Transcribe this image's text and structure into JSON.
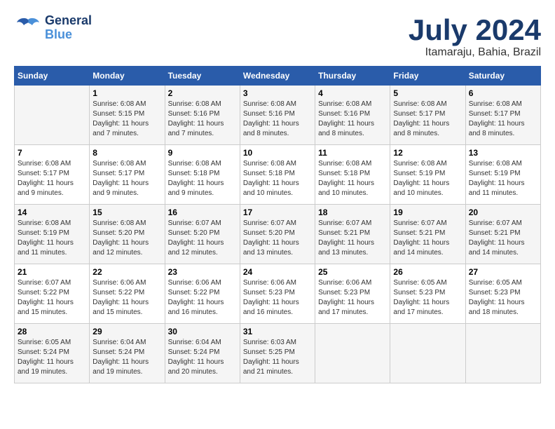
{
  "logo": {
    "general": "General",
    "blue": "Blue"
  },
  "title": {
    "month_year": "July 2024",
    "location": "Itamaraju, Bahia, Brazil"
  },
  "headers": [
    "Sunday",
    "Monday",
    "Tuesday",
    "Wednesday",
    "Thursday",
    "Friday",
    "Saturday"
  ],
  "weeks": [
    [
      {
        "day": "",
        "info": ""
      },
      {
        "day": "1",
        "info": "Sunrise: 6:08 AM\nSunset: 5:15 PM\nDaylight: 11 hours\nand 7 minutes."
      },
      {
        "day": "2",
        "info": "Sunrise: 6:08 AM\nSunset: 5:16 PM\nDaylight: 11 hours\nand 7 minutes."
      },
      {
        "day": "3",
        "info": "Sunrise: 6:08 AM\nSunset: 5:16 PM\nDaylight: 11 hours\nand 8 minutes."
      },
      {
        "day": "4",
        "info": "Sunrise: 6:08 AM\nSunset: 5:16 PM\nDaylight: 11 hours\nand 8 minutes."
      },
      {
        "day": "5",
        "info": "Sunrise: 6:08 AM\nSunset: 5:17 PM\nDaylight: 11 hours\nand 8 minutes."
      },
      {
        "day": "6",
        "info": "Sunrise: 6:08 AM\nSunset: 5:17 PM\nDaylight: 11 hours\nand 8 minutes."
      }
    ],
    [
      {
        "day": "7",
        "info": "Sunrise: 6:08 AM\nSunset: 5:17 PM\nDaylight: 11 hours\nand 9 minutes."
      },
      {
        "day": "8",
        "info": "Sunrise: 6:08 AM\nSunset: 5:17 PM\nDaylight: 11 hours\nand 9 minutes."
      },
      {
        "day": "9",
        "info": "Sunrise: 6:08 AM\nSunset: 5:18 PM\nDaylight: 11 hours\nand 9 minutes."
      },
      {
        "day": "10",
        "info": "Sunrise: 6:08 AM\nSunset: 5:18 PM\nDaylight: 11 hours\nand 10 minutes."
      },
      {
        "day": "11",
        "info": "Sunrise: 6:08 AM\nSunset: 5:18 PM\nDaylight: 11 hours\nand 10 minutes."
      },
      {
        "day": "12",
        "info": "Sunrise: 6:08 AM\nSunset: 5:19 PM\nDaylight: 11 hours\nand 10 minutes."
      },
      {
        "day": "13",
        "info": "Sunrise: 6:08 AM\nSunset: 5:19 PM\nDaylight: 11 hours\nand 11 minutes."
      }
    ],
    [
      {
        "day": "14",
        "info": "Sunrise: 6:08 AM\nSunset: 5:19 PM\nDaylight: 11 hours\nand 11 minutes."
      },
      {
        "day": "15",
        "info": "Sunrise: 6:08 AM\nSunset: 5:20 PM\nDaylight: 11 hours\nand 12 minutes."
      },
      {
        "day": "16",
        "info": "Sunrise: 6:07 AM\nSunset: 5:20 PM\nDaylight: 11 hours\nand 12 minutes."
      },
      {
        "day": "17",
        "info": "Sunrise: 6:07 AM\nSunset: 5:20 PM\nDaylight: 11 hours\nand 13 minutes."
      },
      {
        "day": "18",
        "info": "Sunrise: 6:07 AM\nSunset: 5:21 PM\nDaylight: 11 hours\nand 13 minutes."
      },
      {
        "day": "19",
        "info": "Sunrise: 6:07 AM\nSunset: 5:21 PM\nDaylight: 11 hours\nand 14 minutes."
      },
      {
        "day": "20",
        "info": "Sunrise: 6:07 AM\nSunset: 5:21 PM\nDaylight: 11 hours\nand 14 minutes."
      }
    ],
    [
      {
        "day": "21",
        "info": "Sunrise: 6:07 AM\nSunset: 5:22 PM\nDaylight: 11 hours\nand 15 minutes."
      },
      {
        "day": "22",
        "info": "Sunrise: 6:06 AM\nSunset: 5:22 PM\nDaylight: 11 hours\nand 15 minutes."
      },
      {
        "day": "23",
        "info": "Sunrise: 6:06 AM\nSunset: 5:22 PM\nDaylight: 11 hours\nand 16 minutes."
      },
      {
        "day": "24",
        "info": "Sunrise: 6:06 AM\nSunset: 5:23 PM\nDaylight: 11 hours\nand 16 minutes."
      },
      {
        "day": "25",
        "info": "Sunrise: 6:06 AM\nSunset: 5:23 PM\nDaylight: 11 hours\nand 17 minutes."
      },
      {
        "day": "26",
        "info": "Sunrise: 6:05 AM\nSunset: 5:23 PM\nDaylight: 11 hours\nand 17 minutes."
      },
      {
        "day": "27",
        "info": "Sunrise: 6:05 AM\nSunset: 5:23 PM\nDaylight: 11 hours\nand 18 minutes."
      }
    ],
    [
      {
        "day": "28",
        "info": "Sunrise: 6:05 AM\nSunset: 5:24 PM\nDaylight: 11 hours\nand 19 minutes."
      },
      {
        "day": "29",
        "info": "Sunrise: 6:04 AM\nSunset: 5:24 PM\nDaylight: 11 hours\nand 19 minutes."
      },
      {
        "day": "30",
        "info": "Sunrise: 6:04 AM\nSunset: 5:24 PM\nDaylight: 11 hours\nand 20 minutes."
      },
      {
        "day": "31",
        "info": "Sunrise: 6:03 AM\nSunset: 5:25 PM\nDaylight: 11 hours\nand 21 minutes."
      },
      {
        "day": "",
        "info": ""
      },
      {
        "day": "",
        "info": ""
      },
      {
        "day": "",
        "info": ""
      }
    ]
  ]
}
